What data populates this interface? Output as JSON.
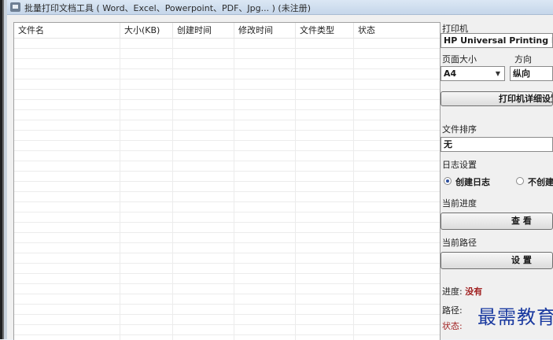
{
  "window": {
    "title": "批量打印文档工具 ( Word、Excel、Powerpoint、PDF、Jpg... ) (未注册)",
    "icon": "printer-app-icon"
  },
  "file_list": {
    "columns": [
      "文件名",
      "大小(KB)",
      "创建时间",
      "修改时间",
      "文件类型",
      "状态"
    ],
    "rows": []
  },
  "panel": {
    "printer_label": "打印机",
    "printer_value": "HP Universal Printing PCL",
    "page_size_label": "页面大小",
    "page_size_value": "A4",
    "orientation_label": "方向",
    "orientation_value": "纵向",
    "printer_details_button": "打印机详细设置",
    "sort_label": "文件排序",
    "sort_value": "无",
    "log_label": "日志设置",
    "log_create": "创建日志",
    "log_none": "不创建",
    "progress_label": "当前进度",
    "view_button": "查  看",
    "path_label": "当前路径",
    "set_button": "设  置",
    "status_progress_label": "进度:",
    "status_progress_value": "没有",
    "status_path_label": "路径:",
    "status_state_label": "状态:"
  },
  "watermark": "最需教育"
}
